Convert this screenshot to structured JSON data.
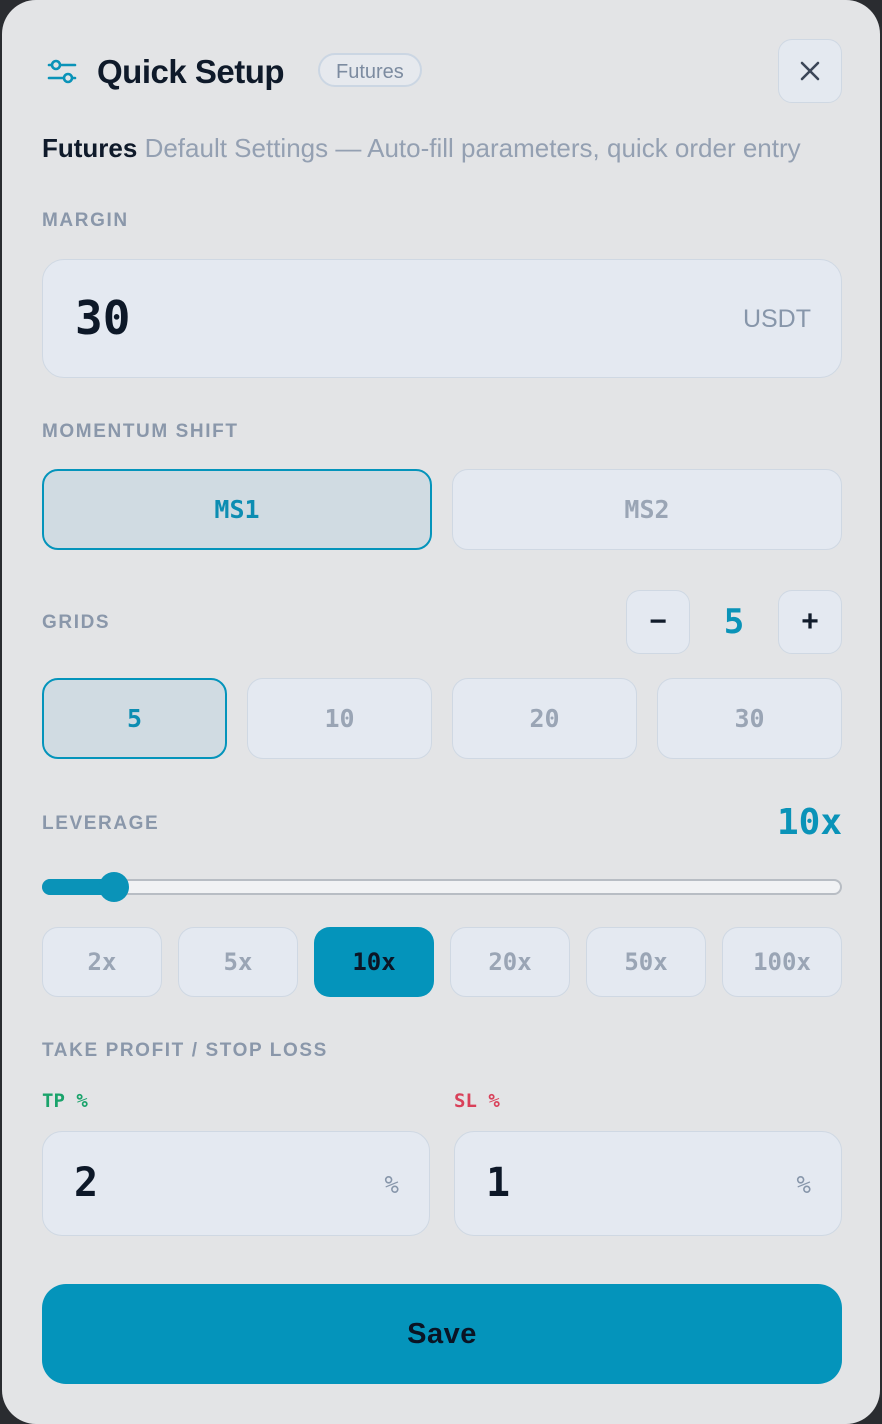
{
  "header": {
    "title": "Quick Setup",
    "badge": "Futures",
    "icon": "sliders-icon",
    "close_icon": "close-icon"
  },
  "subtitle": {
    "strong": "Futures",
    "text": " Default Settings — Auto-fill parameters, quick order entry"
  },
  "margin": {
    "label": "MARGIN",
    "value": "30",
    "unit": "USDT"
  },
  "momentum": {
    "label": "MOMENTUM SHIFT",
    "options": [
      "MS1",
      "MS2"
    ],
    "selected": "MS1"
  },
  "grids": {
    "label": "GRIDS",
    "minus": "−",
    "plus": "+",
    "value": "5",
    "options": [
      "5",
      "10",
      "20",
      "30"
    ],
    "selected": "5"
  },
  "leverage": {
    "label": "LEVERAGE",
    "value": "10x",
    "slider_fraction": 0.09,
    "options": [
      "2x",
      "5x",
      "10x",
      "20x",
      "50x",
      "100x"
    ],
    "selected": "10x"
  },
  "tpsl": {
    "label": "TAKE PROFIT / STOP LOSS",
    "tp_label": "TP %",
    "tp_value": "2",
    "tp_unit": "%",
    "sl_label": "SL %",
    "sl_value": "1",
    "sl_unit": "%"
  },
  "save_label": "Save",
  "colors": {
    "accent": "#0494bb",
    "tp": "#1aa36b",
    "sl": "#d9415a"
  }
}
